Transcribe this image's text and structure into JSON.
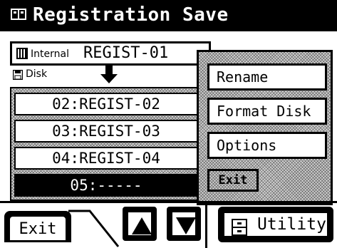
{
  "title": "Registration Save",
  "internal": {
    "label": "Internal",
    "name": "REGIST-01"
  },
  "disk": {
    "label": "Disk"
  },
  "list": {
    "items": [
      {
        "label": "02:REGIST-02",
        "selected": false
      },
      {
        "label": "03:REGIST-03",
        "selected": false
      },
      {
        "label": "04:REGIST-04",
        "selected": false
      },
      {
        "label": "05:-----",
        "selected": true
      }
    ]
  },
  "popup": {
    "items": [
      "Rename",
      "Format Disk",
      "Options"
    ],
    "exit_label": "Exit"
  },
  "bottom": {
    "exit_label": "Exit",
    "utility_label": "Utility"
  },
  "icons": {
    "title": "floppy-book-icon",
    "internal": "piano-keys-icon",
    "disk": "floppy-disk-icon",
    "transfer": "down-arrow-icon",
    "up": "up-triangle-icon",
    "down": "down-triangle-icon",
    "utility": "cabinet-icon"
  }
}
